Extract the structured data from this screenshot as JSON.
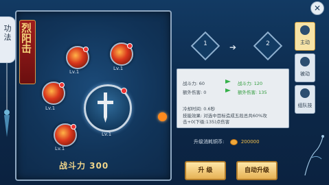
{
  "left_tab": {
    "label": "功法"
  },
  "tree": {
    "title": "烈阳击",
    "power_label": "战斗力 300",
    "skills": [
      {
        "level": "Lv.1"
      },
      {
        "level": "Lv.1"
      },
      {
        "level": "Lv.1"
      },
      {
        "level": "Lv.1"
      },
      {
        "level": "Lv.1"
      }
    ],
    "big_skill_level": "Lv.1"
  },
  "upgrade": {
    "from": "1",
    "to": "2"
  },
  "stats": {
    "power_label": "战斗力: 60",
    "power_new": "战斗力: 120",
    "extra_label": "额外伤害: 0",
    "extra_new": "额外伤害: 135",
    "cooldown": "冷却时间:  0.6秒",
    "effect_line1": "技能效果:  对选中目标造成五段总共60%攻",
    "effect_line2": "击+0(下级:135)点伤害"
  },
  "cost": {
    "label": "升级消耗铜币:",
    "value": "200000"
  },
  "buttons": {
    "upgrade": "升 级",
    "auto_upgrade": "自动升级"
  },
  "right_tabs": [
    {
      "label": "主动",
      "active": true
    },
    {
      "label": "被动",
      "active": false
    },
    {
      "label": "组队技",
      "active": false
    }
  ],
  "close": "✕"
}
